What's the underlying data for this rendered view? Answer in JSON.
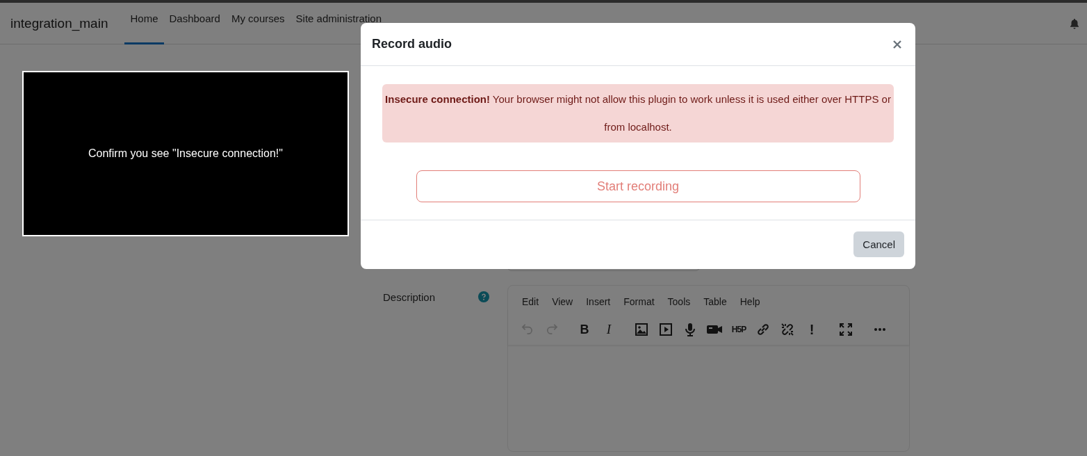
{
  "navbar": {
    "brand": "integration_main",
    "items": [
      {
        "label": "Home",
        "selected": true
      },
      {
        "label": "Dashboard",
        "selected": false
      },
      {
        "label": "My courses",
        "selected": false
      },
      {
        "label": "Site administration",
        "selected": false
      }
    ]
  },
  "instruction": {
    "text": "Confirm you see \"Insecure connection!\""
  },
  "form": {
    "description_label": "Description",
    "editor": {
      "menu": [
        "Edit",
        "View",
        "Insert",
        "Format",
        "Tools",
        "Table",
        "Help"
      ],
      "toolbar": [
        {
          "kind": "undo",
          "disabled": true
        },
        {
          "kind": "redo",
          "disabled": true
        },
        {
          "kind": "bold",
          "glyph": "B",
          "disabled": false
        },
        {
          "kind": "italic",
          "glyph": "I",
          "disabled": false
        },
        {
          "kind": "image",
          "disabled": false
        },
        {
          "kind": "media",
          "disabled": false
        },
        {
          "kind": "microphone",
          "disabled": false
        },
        {
          "kind": "camera",
          "disabled": false
        },
        {
          "kind": "h5p",
          "glyph": "H5P",
          "disabled": false
        },
        {
          "kind": "link",
          "disabled": false
        },
        {
          "kind": "unlink",
          "disabled": false
        },
        {
          "kind": "important",
          "glyph": "!",
          "disabled": false
        },
        {
          "kind": "fullscreen",
          "disabled": false
        },
        {
          "kind": "more",
          "disabled": false
        }
      ]
    }
  },
  "modal": {
    "title": "Record audio",
    "alert": "**Insecure connection!** Your browser might not allow this plugin to work unless it is used either over HTTPS or from localhost.",
    "record_button": "Start recording",
    "cancel_button": "Cancel"
  }
}
